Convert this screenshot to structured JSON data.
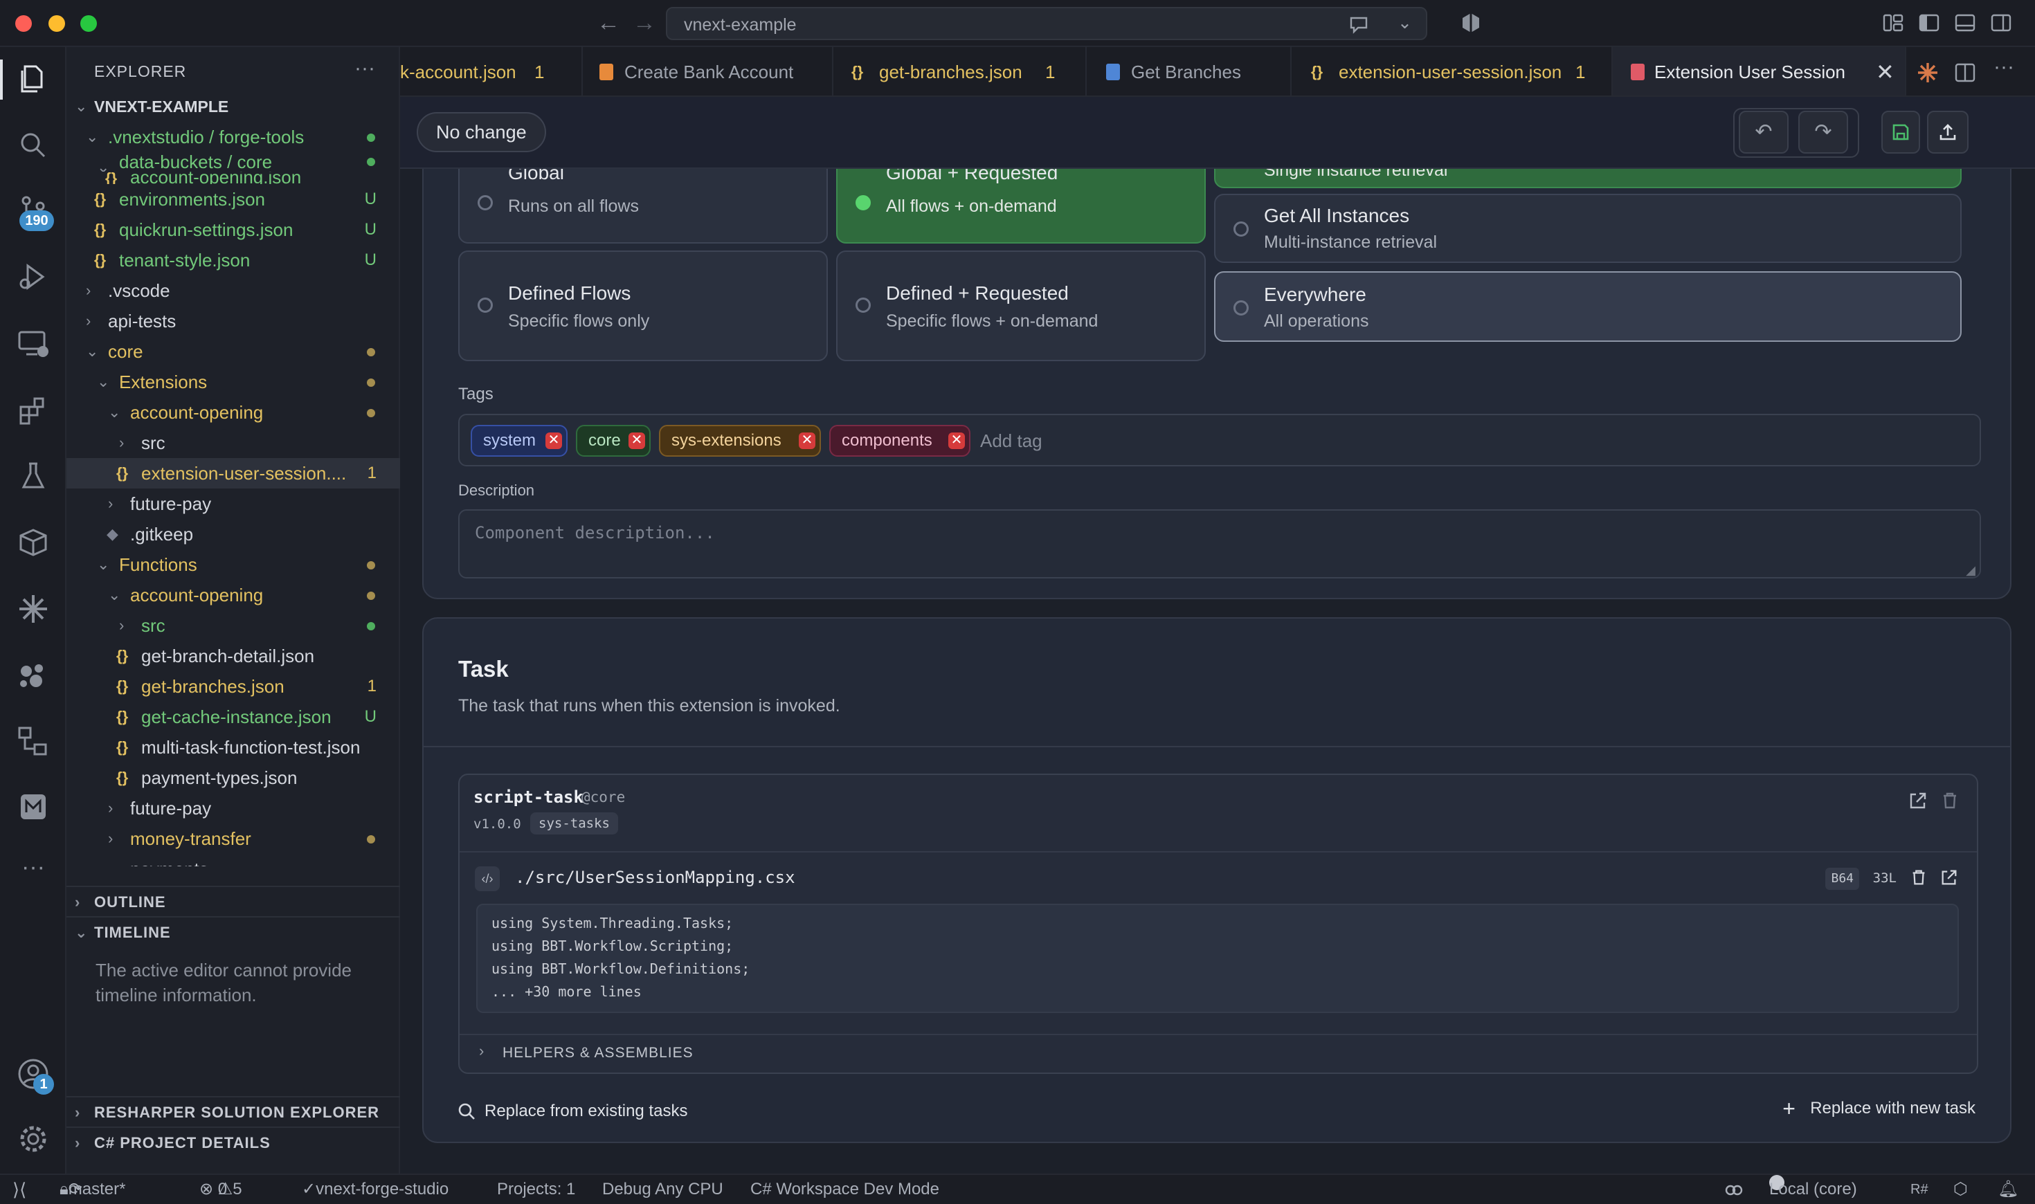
{
  "window": {
    "search": "vnext-example"
  },
  "activity": {
    "scm_badge": "190",
    "account_badge": "1"
  },
  "explorer": {
    "title": "EXPLORER",
    "root": "VNEXT-EXAMPLE",
    "rows": [
      {
        "label": ".vnextstudio / forge-tools",
        "status": ""
      },
      {
        "label": "data-buckets / core",
        "status": ""
      },
      {
        "label": "account-opening.json",
        "status": ""
      },
      {
        "label": "environments.json",
        "status": "U"
      },
      {
        "label": "quickrun-settings.json",
        "status": "U"
      },
      {
        "label": "tenant-style.json",
        "status": "U"
      },
      {
        "label": ".vscode",
        "status": ""
      },
      {
        "label": "api-tests",
        "status": ""
      },
      {
        "label": "core",
        "status": ""
      },
      {
        "label": "Extensions",
        "status": ""
      },
      {
        "label": "account-opening",
        "status": ""
      },
      {
        "label": "src",
        "status": ""
      },
      {
        "label": "extension-user-session....",
        "status": "1"
      },
      {
        "label": "future-pay",
        "status": ""
      },
      {
        "label": ".gitkeep",
        "status": ""
      },
      {
        "label": "Functions",
        "status": ""
      },
      {
        "label": "account-opening",
        "status": ""
      },
      {
        "label": "src",
        "status": ""
      },
      {
        "label": "get-branch-detail.json",
        "status": ""
      },
      {
        "label": "get-branches.json",
        "status": "1"
      },
      {
        "label": "get-cache-instance.json",
        "status": "U"
      },
      {
        "label": "multi-task-function-test.json",
        "status": ""
      },
      {
        "label": "payment-types.json",
        "status": ""
      },
      {
        "label": "future-pay",
        "status": ""
      },
      {
        "label": "money-transfer",
        "status": ""
      },
      {
        "label": "payments",
        "status": ""
      }
    ],
    "outline": "OUTLINE",
    "timeline": "TIMELINE",
    "timeline_msg": "The active editor cannot provide timeline information.",
    "resharper": "RESHARPER SOLUTION EXPLORER",
    "csproj": "C# PROJECT DETAILS"
  },
  "tabs": [
    {
      "label": "k-account.json",
      "count": "1"
    },
    {
      "label": "Create Bank Account",
      "count": ""
    },
    {
      "label": "get-branches.json",
      "count": "1"
    },
    {
      "label": "Get Branches",
      "count": ""
    },
    {
      "label": "extension-user-session.json",
      "count": "1"
    },
    {
      "label": "Extension User Session",
      "count": ""
    }
  ],
  "toolbar": {
    "status": "No change"
  },
  "scope": {
    "options": [
      {
        "title": "Global",
        "sub": "Runs on all flows"
      },
      {
        "title": "Global + Requested",
        "sub": "All flows + on-demand"
      },
      {
        "title": "Defined Flows",
        "sub": "Specific flows only"
      },
      {
        "title": "Defined + Requested",
        "sub": "Specific flows + on-demand"
      }
    ],
    "right": [
      {
        "title": "",
        "sub": "Single instance retrieval"
      },
      {
        "title": "Get All Instances",
        "sub": "Multi-instance retrieval"
      },
      {
        "title": "Everywhere",
        "sub": "All operations"
      }
    ]
  },
  "tags": {
    "label": "Tags",
    "items": [
      "system",
      "core",
      "sys-extensions",
      "components"
    ],
    "placeholder": "Add tag"
  },
  "description": {
    "label": "Description",
    "placeholder": "Component description..."
  },
  "task": {
    "title": "Task",
    "subtitle": "The task that runs when this extension is invoked.",
    "name": "script-task",
    "domain": "@core",
    "version": "v1.0.0",
    "flow": "sys-tasks",
    "file": "./src/UserSessionMapping.csx",
    "b64": "B64",
    "lines": "33L",
    "code": [
      "using System.Threading.Tasks;",
      "using BBT.Workflow.Scripting;",
      "using BBT.Workflow.Definitions;",
      "... +30 more lines"
    ],
    "helpers": "HELPERS & ASSEMBLIES",
    "replace_existing": "Replace from existing tasks",
    "replace_new": "Replace with new task"
  },
  "status": {
    "branch": "master*",
    "errors": "0",
    "warnings": "5",
    "project": "vnext-forge-studio",
    "projects": "Projects: 1",
    "debug": "Debug Any CPU",
    "mode": "C# Workspace Dev Mode",
    "env": "Local (core)"
  }
}
